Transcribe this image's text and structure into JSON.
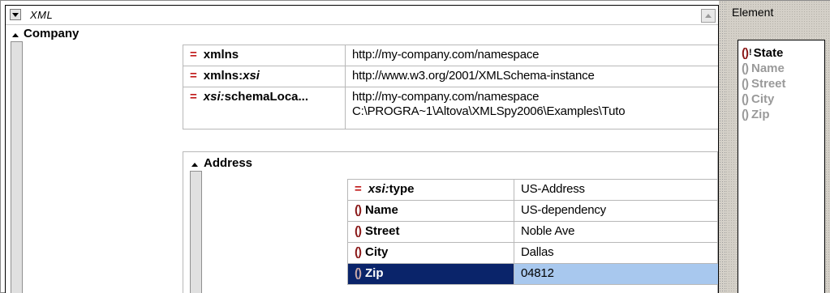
{
  "grid": {
    "title": "XML",
    "root_element": "Company",
    "attributes": [
      {
        "name": "xmlns",
        "value": "http://my-company.com/namespace"
      },
      {
        "name_prefix": "xmlns:",
        "name_italic": "xsi",
        "value": "http://www.w3.org/2001/XMLSchema-instance"
      },
      {
        "name_italic": "xsi:",
        "name_suffix": "schemaLoca...",
        "value_line1": "http://my-company.com/namespace",
        "value_line2": "C:\\PROGRA~1\\Altova\\XMLSpy2006\\Examples\\Tuto"
      }
    ],
    "child_element": "Address",
    "address_rows": [
      {
        "kind": "attribute",
        "name_italic": "xsi:",
        "name_suffix": "type",
        "value": "US-Address"
      },
      {
        "kind": "element",
        "name": "Name",
        "value": "US-dependency"
      },
      {
        "kind": "element",
        "name": "Street",
        "value": "Noble Ave"
      },
      {
        "kind": "element",
        "name": "City",
        "value": "Dallas"
      },
      {
        "kind": "element",
        "name": "Zip",
        "value": "04812",
        "selected": true
      }
    ]
  },
  "element_pane": {
    "title": "Element",
    "items": [
      {
        "label": "State",
        "state": "available"
      },
      {
        "label": "Name",
        "state": "used"
      },
      {
        "label": "Street",
        "state": "used"
      },
      {
        "label": "City",
        "state": "used"
      },
      {
        "label": "Zip",
        "state": "used"
      }
    ]
  },
  "icons": {
    "attribute": "equals-sign",
    "element": "braces",
    "collapse": "triangle-up",
    "menu": "triangle-down"
  },
  "colors": {
    "attribute_icon": "#c01818",
    "element_icon": "#8a1818",
    "selection_name": "#0a246a",
    "selection_value": "#a8c8ee",
    "disabled_text": "#9a9a9a"
  }
}
